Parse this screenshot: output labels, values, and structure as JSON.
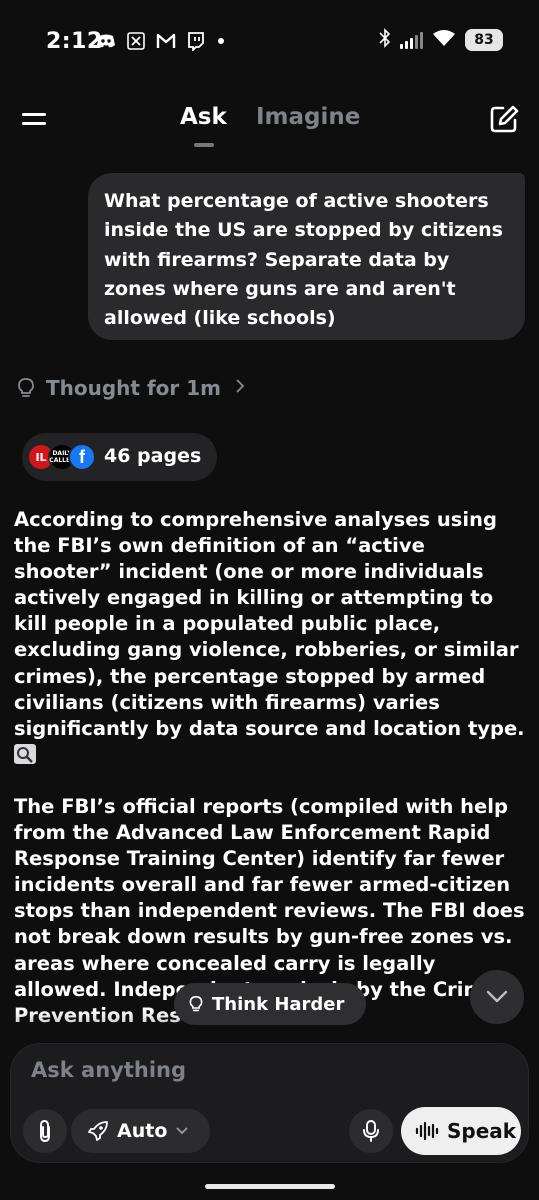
{
  "status_bar": {
    "time": "2:12",
    "battery": "83",
    "notification_icons": [
      "discord-icon",
      "x-icon",
      "gmail-icon",
      "twitch-icon",
      "dot-icon"
    ],
    "system_icons": [
      "bluetooth-icon",
      "signal-icon",
      "wifi-icon",
      "battery-icon"
    ]
  },
  "header": {
    "tabs": [
      {
        "label": "Ask",
        "active": true
      },
      {
        "label": "Imagine",
        "active": false
      }
    ]
  },
  "user_message": "What percentage of active shooters inside the US are stopped by citizens with firearms? Separate data by zones where guns are and aren't allowed (like schools)",
  "thought": {
    "label": "Thought for 1m"
  },
  "sources": {
    "label": "46 pages",
    "favicons": [
      {
        "name": "il-favicon",
        "text": "IL"
      },
      {
        "name": "daily-caller-favicon",
        "text": "DAILY CALLER"
      },
      {
        "name": "facebook-favicon",
        "text": "f"
      }
    ]
  },
  "response": {
    "paragraphs": [
      "According to comprehensive analyses using the FBI’s own definition of an “active shooter” incident (one or more individuals actively engaged in killing or attempting to kill people in a populated public place, excluding gang violence, robberies, or similar crimes), the percentage stopped by armed civilians (citizens with firearms) varies significantly by data source and location type.",
      "The FBI’s official reports (compiled with help from the Advanced Law Enforcement Rapid Response Training Center) identify far fewer incidents overall and far fewer armed-citizen stops than independent reviews. The FBI does not break down results by gun-free zones vs. areas where concealed carry is legally allowed. Independent analysis by the Crime Prevention Research"
    ]
  },
  "overlay": {
    "think_harder": "Think Harder"
  },
  "composer": {
    "placeholder": "Ask anything",
    "mode": "Auto",
    "speak": "Speak"
  },
  "colors": {
    "background": "#0e0e0f",
    "bubble": "#2a2a2c",
    "muted_text": "#868a91",
    "speak_button": "#efefef"
  }
}
